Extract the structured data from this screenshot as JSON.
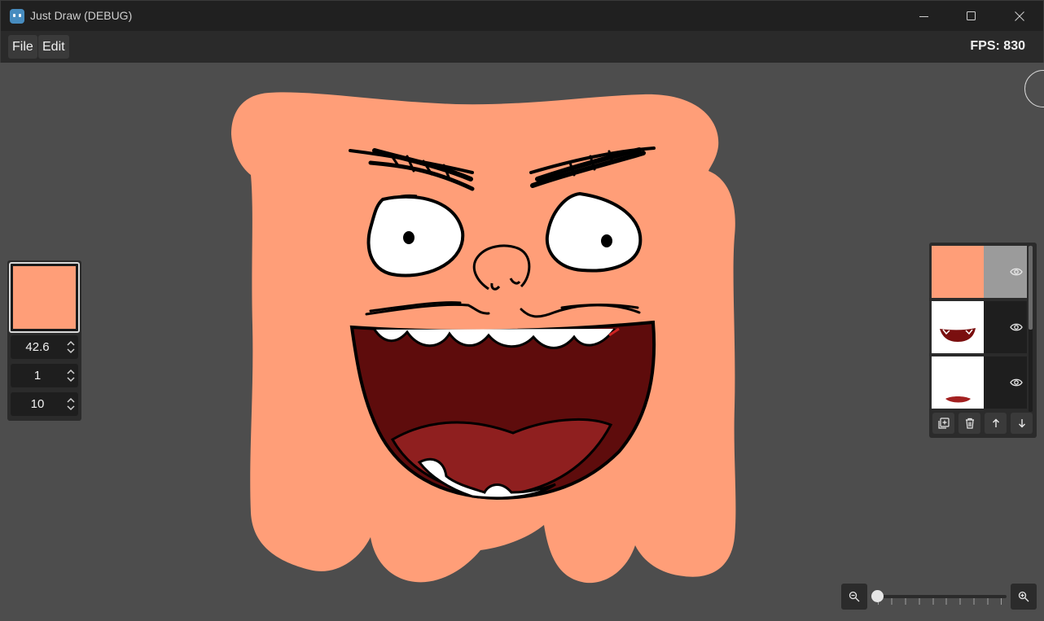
{
  "window": {
    "title": "Just Draw (DEBUG)"
  },
  "menu": {
    "file_label": "File",
    "edit_label": "Edit"
  },
  "status": {
    "fps_text": "FPS: 830"
  },
  "brush": {
    "color": "#ff9e78",
    "size_value": "42.6",
    "opacity_value": "1",
    "third_value": "10"
  },
  "layers": [
    {
      "thumb": "solid-peach",
      "selected": true
    },
    {
      "thumb": "open-mouth",
      "selected": false
    },
    {
      "thumb": "lips",
      "selected": false
    }
  ],
  "zoom": {
    "level": 0.0
  },
  "colors": {
    "background": "#4d4d4d",
    "skin": "#ff9e78",
    "mouth_dark": "#5e0c0c",
    "tongue": "#8f1f1f",
    "outline": "#000000",
    "panel": "#2b2b2b"
  }
}
